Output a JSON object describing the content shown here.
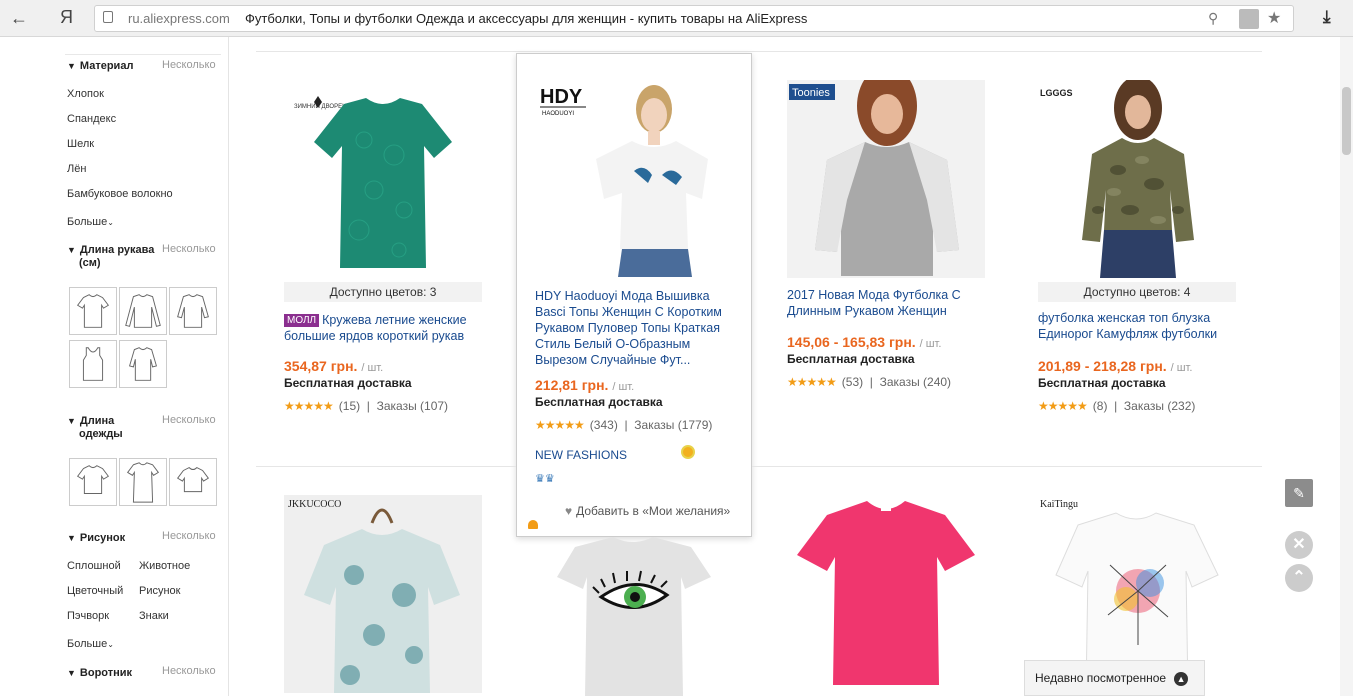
{
  "browser": {
    "domain": "ru.aliexpress.com",
    "title": "Футболки, Топы и футболки Одежда и аксессуары для женщин - купить товары на AliExpress",
    "back_icon": "←",
    "ya_logo": "Я"
  },
  "sidebar": {
    "material": {
      "title": "Материал",
      "more": "Несколько",
      "options": [
        "Хлопок",
        "Спандекс",
        "Шелк",
        "Лён",
        "Бамбуковое волокно"
      ],
      "show_more": "Больше"
    },
    "sleeve": {
      "title_line1": "Длина рукава",
      "title_line2": "(см)",
      "more": "Несколько"
    },
    "length": {
      "title_line1": "Длина",
      "title_line2": "одежды",
      "more": "Несколько"
    },
    "pattern": {
      "title": "Рисунок",
      "more": "Несколько",
      "options": [
        "Сплошной",
        "Животное",
        "Цветочный",
        "Рисунок",
        "Пэчворк",
        "Знаки"
      ],
      "show_more": "Больше"
    },
    "collar": {
      "title": "Воротник",
      "more": "Несколько"
    }
  },
  "products": [
    {
      "avail": "Доступно цветов: 3",
      "mall": "МОЛЛ",
      "title": "Кружева летние женские большие ярдов короткий рукав",
      "price": "354,87 грн.",
      "unit": "/ шт.",
      "shipping": "Бесплатная доставка",
      "reviews": "(15)",
      "orders": "Заказы (107)",
      "brand": "ЗИМНИЙ ДВОРЕЦ",
      "color": "#1d8a73"
    },
    {
      "title": "HDY Haoduoyi Мода Вышивка Basci Топы Женщин С Коротким Рукавом Пуловер Топы Краткая Стиль Белый О-Образным Вырезом Случайные Фут...",
      "price": "212,81 грн.",
      "unit": "/ шт.",
      "shipping": "Бесплатная доставка",
      "reviews": "(343)",
      "orders": "Заказы (1779)",
      "store": "NEW FASHIONS",
      "wishlist": "Добавить в «Мои желания»",
      "brand": "HDY",
      "brand_sub": "HAODUOYI"
    },
    {
      "title": "2017 Новая Мода Футболка С Длинным Рукавом Женщин",
      "price": "145,06 - 165,83 грн.",
      "unit": "/ шт.",
      "shipping": "Бесплатная доставка",
      "reviews": "(53)",
      "orders": "Заказы (240)",
      "brand": "Toonies"
    },
    {
      "avail": "Доступно цветов: 4",
      "title": "футболка женская топ блузка Единорог Камуфляж футболки",
      "price": "201,89 - 218,28 грн.",
      "unit": "/ шт.",
      "shipping": "Бесплатная доставка",
      "reviews": "(8)",
      "orders": "Заказы (232)",
      "brand": "LGGGS"
    }
  ],
  "row2": [
    {
      "brand": "JKKUCOCO"
    },
    {
      "brand": ""
    },
    {
      "brand": ""
    },
    {
      "brand": "KaiTingu"
    }
  ],
  "stars": "★★★★★",
  "recent": {
    "label": "Недавно посмотренное"
  },
  "colors": {
    "price": "#e9661f",
    "link": "#1a4b8f",
    "stars": "#f29c16",
    "mall": "#8b2f8f"
  }
}
